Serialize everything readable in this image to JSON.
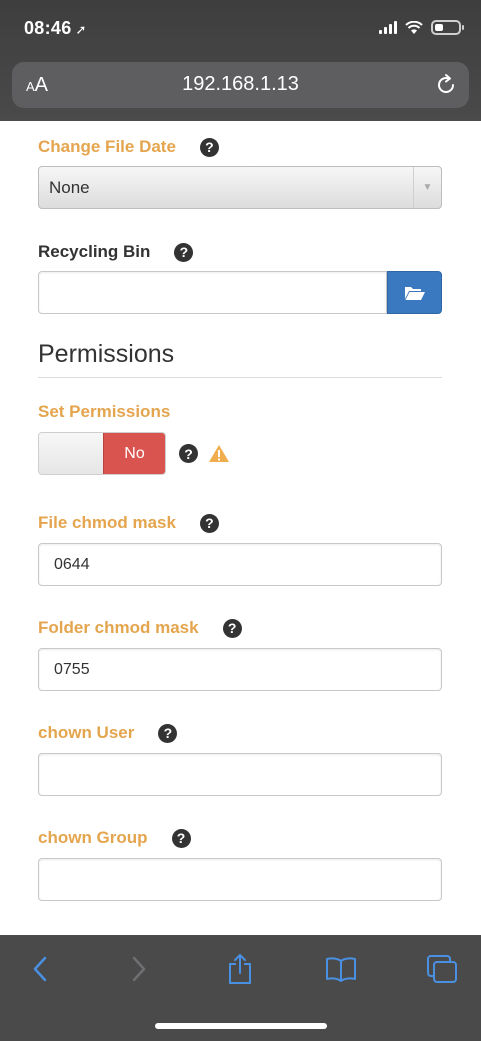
{
  "status": {
    "time": "08:46"
  },
  "browser": {
    "text_size_label_small": "A",
    "text_size_label_large": "A",
    "url": "192.168.1.13"
  },
  "form": {
    "change_file_date": {
      "label": "Change File Date",
      "help": "?",
      "selected": "None"
    },
    "recycling_bin": {
      "label": "Recycling Bin",
      "help": "?",
      "value": ""
    },
    "permissions_section": "Permissions",
    "set_permissions": {
      "label": "Set Permissions",
      "state": "No",
      "help": "?"
    },
    "file_chmod": {
      "label": "File chmod mask",
      "help": "?",
      "value": "0644"
    },
    "folder_chmod": {
      "label": "Folder chmod mask",
      "help": "?",
      "value": "0755"
    },
    "chown_user": {
      "label": "chown User",
      "help": "?",
      "value": ""
    },
    "chown_group": {
      "label": "chown Group",
      "help": "?",
      "value": ""
    }
  },
  "colors": {
    "label_orange": "#e4a54e",
    "toggle_red": "#d9534f",
    "folder_blue": "#3a78bf",
    "toolbar_blue": "#4a90e2",
    "warning": "#f0ad4e"
  },
  "toolbar_icons": [
    "back-icon",
    "forward-icon",
    "share-icon",
    "bookmarks-icon",
    "tabs-icon"
  ]
}
